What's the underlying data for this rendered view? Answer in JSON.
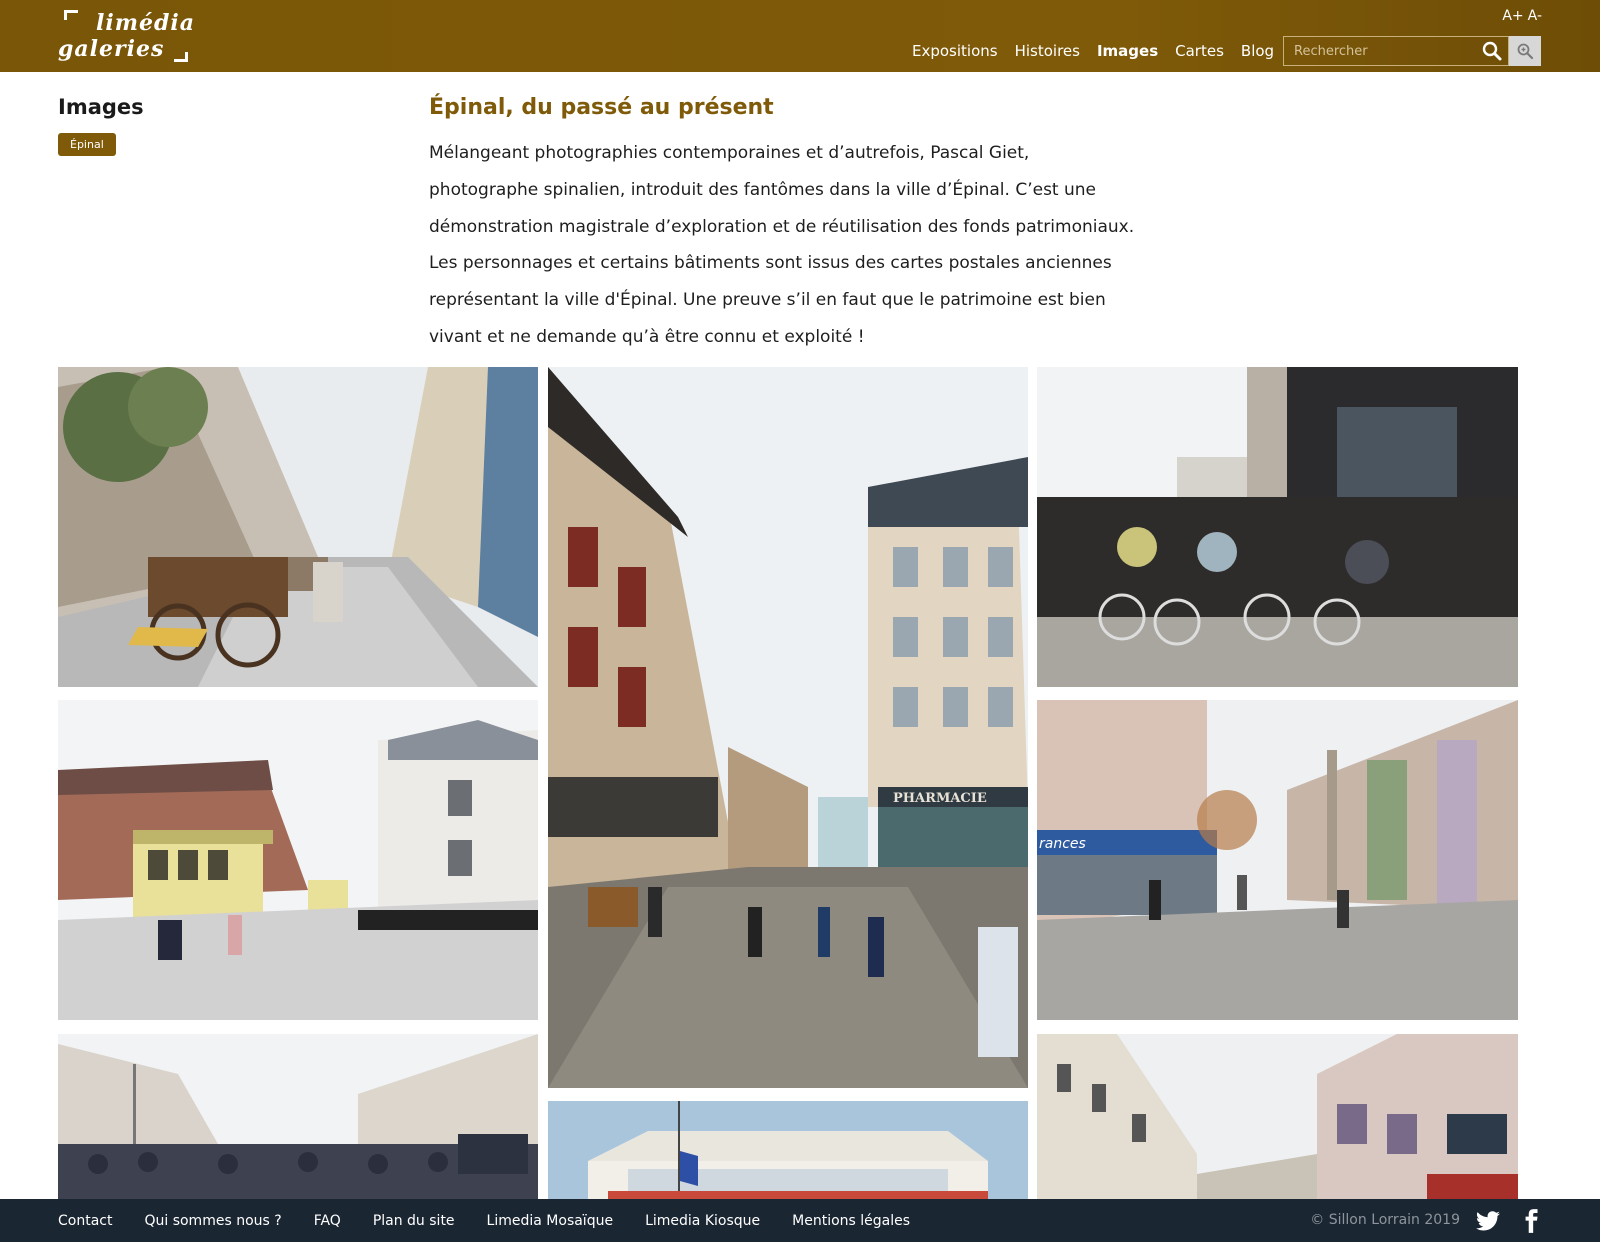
{
  "header": {
    "logo_line1": "limédia",
    "logo_line2": "galeries",
    "font_increase": "A+",
    "font_decrease": "A-",
    "nav": [
      {
        "label": "Expositions",
        "active": false
      },
      {
        "label": "Histoires",
        "active": false
      },
      {
        "label": "Images",
        "active": true
      },
      {
        "label": "Cartes",
        "active": false
      },
      {
        "label": "Blog",
        "active": false
      }
    ],
    "search_placeholder": "Rechercher"
  },
  "sidebar": {
    "title": "Images",
    "tag": "Épinal"
  },
  "article": {
    "title": "Épinal, du passé au présent",
    "lines": [
      "Mélangeant photographies contemporaines et d’autrefois, Pascal Giet,",
      "photographe spinalien, introduit des fantômes dans la ville d’Épinal. C’est une",
      "démonstration magistrale d’exploration et de réutilisation des fonds patrimoniaux.",
      "Les personnages et certains bâtiments sont issus des cartes postales anciennes",
      "représentant la ville d'Épinal. Une preuve s’il en faut que le patrimoine est bien",
      "vivant et ne demande qu’à être connu et exploité !"
    ]
  },
  "gallery": {
    "photos": [
      {
        "name": "photo-street-cart",
        "subject": "street-cart"
      },
      {
        "name": "photo-square-pharmacie",
        "subject": "square-pharmacie",
        "sign": "PHARMACIE"
      },
      {
        "name": "photo-cyclists",
        "subject": "cyclists"
      },
      {
        "name": "photo-tram-crossing",
        "subject": "tram-crossing"
      },
      {
        "name": "photo-square-fountain",
        "subject": "square-fountain",
        "sign": "rances"
      },
      {
        "name": "photo-soldiers-street",
        "subject": "soldiers-street"
      },
      {
        "name": "photo-building-flag",
        "subject": "building-flag"
      },
      {
        "name": "photo-street-buildings",
        "subject": "street-buildings"
      }
    ]
  },
  "footer": {
    "links": [
      "Contact",
      "Qui sommes nous ?",
      "FAQ",
      "Plan du site",
      "Limedia Mosaïque",
      "Limedia Kiosque",
      "Mentions légales"
    ],
    "copyright": "© Sillon Lorrain 2019",
    "social": [
      "twitter-icon",
      "facebook-icon"
    ]
  },
  "colors": {
    "brand": "#7e5a09",
    "footer_bg": "#1b2633",
    "text": "#1e1e1e"
  }
}
